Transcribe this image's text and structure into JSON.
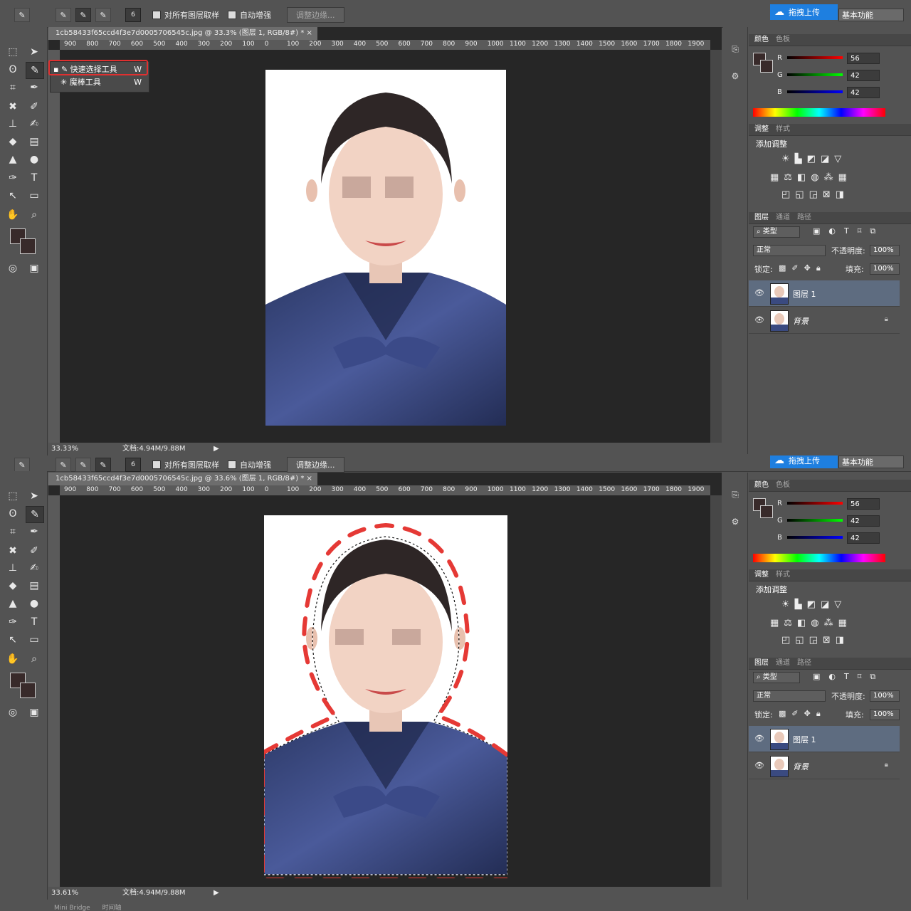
{
  "top": {
    "options": {
      "brush_size": "6",
      "sample_all_label": "对所有图层取样",
      "auto_enhance_label": "自动增强",
      "refine_edge_label": "调整边缘..."
    },
    "upload_label": "拖拽上传",
    "workspace_label": "基本功能",
    "doc_tab": "1cb58433f65ccd4f3e7d0005706545c.jpg @ 33.3% (图层 1, RGB/8#) *  ×",
    "ruler_labels": [
      "900",
      "800",
      "700",
      "600",
      "500",
      "400",
      "300",
      "200",
      "100",
      "0",
      "100",
      "200",
      "300",
      "400",
      "500",
      "600",
      "700",
      "800",
      "900",
      "1000",
      "1100",
      "1200",
      "1300",
      "1400",
      "1500",
      "1600",
      "1700",
      "1800",
      "1900"
    ],
    "flyout": {
      "items": [
        {
          "label": "快速选择工具",
          "key": "W"
        },
        {
          "label": "魔棒工具",
          "key": "W"
        }
      ]
    },
    "status": {
      "zoom": "33.33%",
      "size": "文档:4.94M/9.88M"
    }
  },
  "bottom": {
    "options": {
      "brush_size": "6",
      "sample_all_label": "对所有图层取样",
      "auto_enhance_label": "自动增强",
      "refine_edge_label": "调整边缘..."
    },
    "upload_label": "拖拽上传",
    "workspace_label": "基本功能",
    "doc_tab": "1cb58433f65ccd4f3e7d0005706545c.jpg @ 33.6% (图层 1, RGB/8#) *  ×",
    "status": {
      "zoom": "33.61%",
      "size": "文档:4.94M/9.88M"
    },
    "bottom_tabs": [
      "Mini Bridge",
      "时间轴"
    ]
  },
  "panels": {
    "color_tabs": [
      "颜色",
      "色板"
    ],
    "rgb": [
      {
        "label": "R",
        "value": "56"
      },
      {
        "label": "G",
        "value": "42"
      },
      {
        "label": "B",
        "value": "42"
      }
    ],
    "adjust_tabs": [
      "调整",
      "样式"
    ],
    "adjust_title": "添加调整",
    "layers_tabs": [
      "图层",
      "通道",
      "路径"
    ],
    "kind_label": "类型",
    "blend_mode": "正常",
    "opacity_label": "不透明度:",
    "opacity_value": "100%",
    "lock_label": "锁定:",
    "fill_label": "填充:",
    "fill_value": "100%",
    "layers": [
      {
        "name": "图层 1"
      },
      {
        "name": "背景"
      }
    ]
  },
  "colors": {
    "foreground": "#382a2a",
    "selection_outline": "#e53935",
    "upload_blue": "#1e7fe0"
  }
}
